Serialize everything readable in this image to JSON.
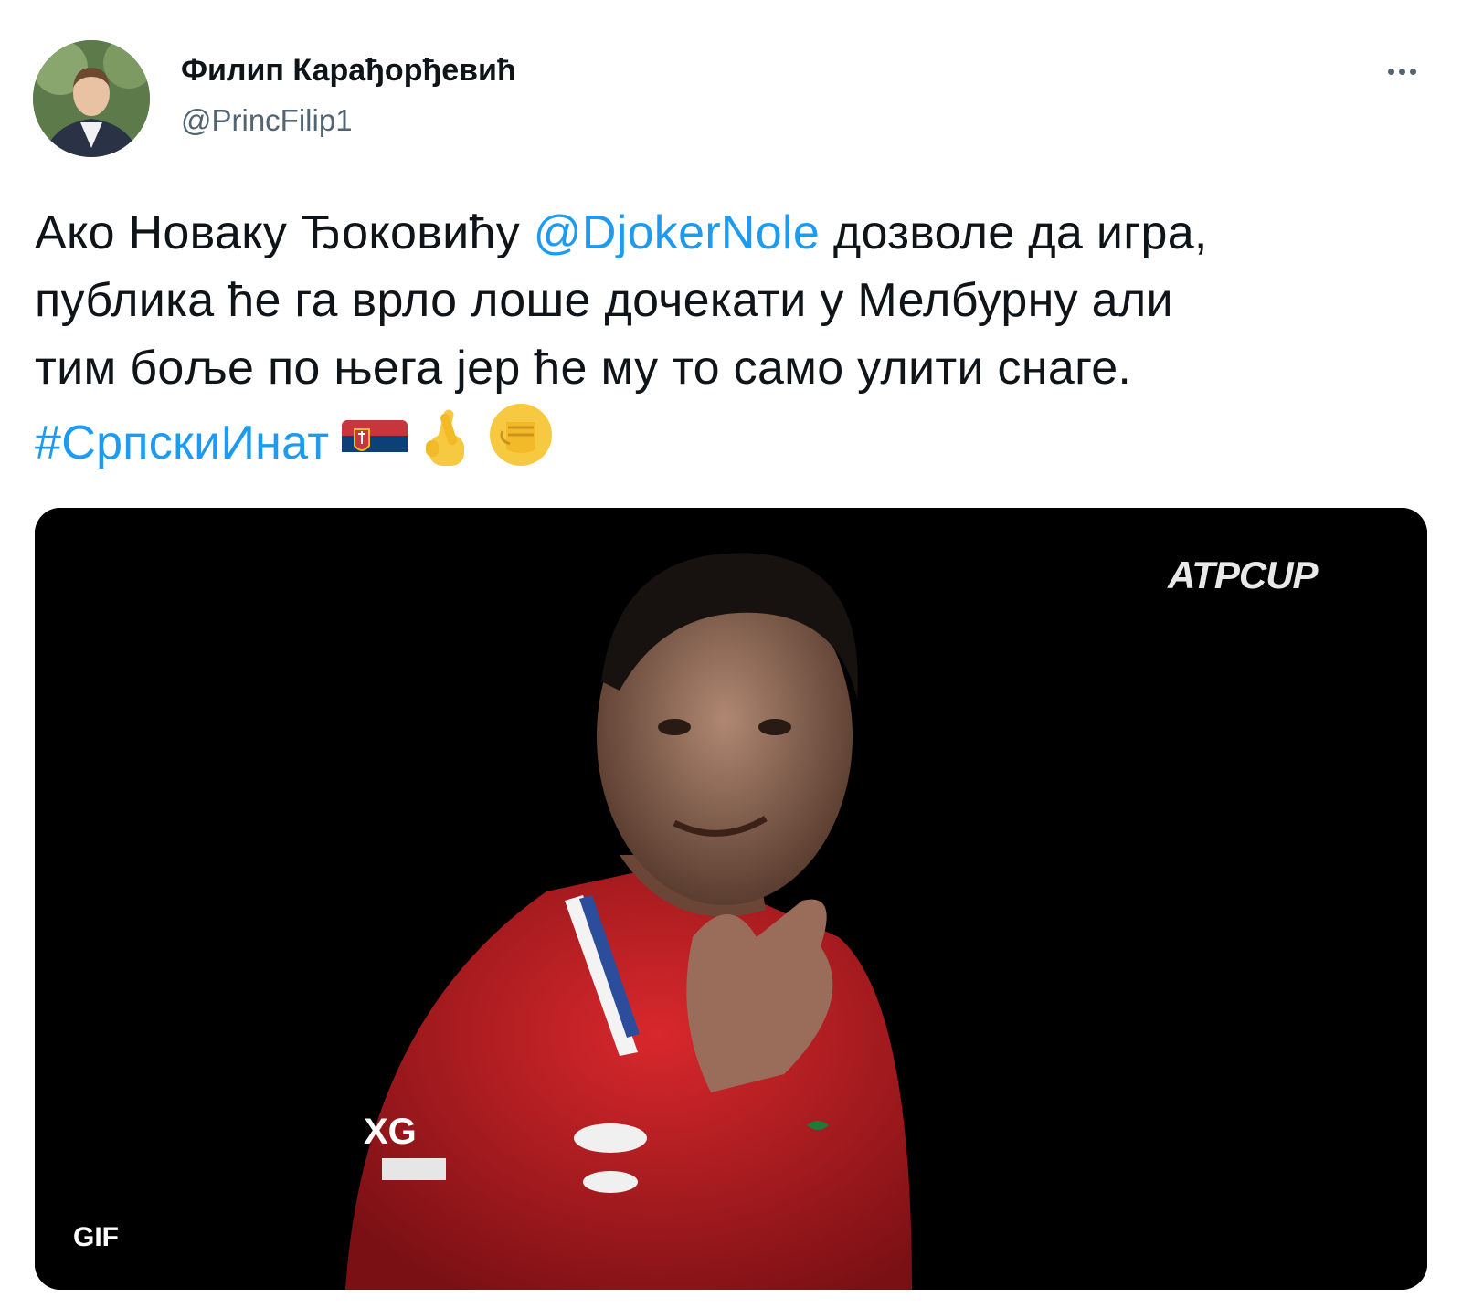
{
  "author": {
    "display_name": "Филип Карађорђевић",
    "handle": "@PrincFilip1"
  },
  "tweet": {
    "lines": [
      [
        {
          "text": "Ако Новаку Ђоковићу ",
          "link": false
        },
        {
          "text": "@DjokerNole",
          "link": true
        },
        {
          "text": " дозволе да игра,",
          "link": false
        }
      ],
      [
        {
          "text": "публика ће га врло лоше дочекати у Мелбурну али",
          "link": false
        }
      ],
      [
        {
          "text": "тим боље по њега јер ће му то само улити снаге.",
          "link": false
        }
      ]
    ],
    "hashtag": "#СрпскиИнат",
    "emojis": [
      "serbia-flag-icon",
      "crossed-fingers-icon",
      "raised-fist-icon"
    ]
  },
  "media": {
    "watermark": "ATPCUP",
    "badge": "GIF"
  },
  "colors": {
    "link": "#1d9bf0",
    "text": "#0f1419",
    "secondary": "#536471",
    "media_bg": "#000000"
  }
}
